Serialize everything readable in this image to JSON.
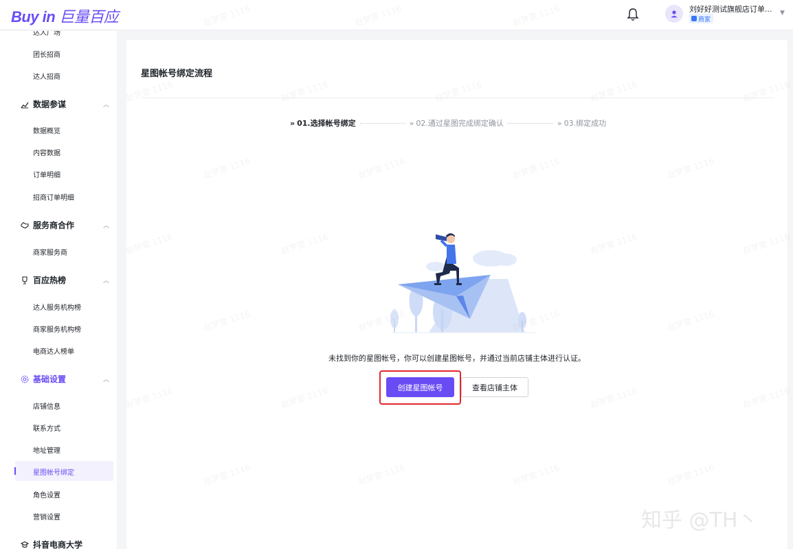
{
  "header": {
    "logo_text": "Buy in",
    "logo_cn": "巨量百应",
    "user_name": "刘好好测试旗舰店订单...",
    "user_role": "商家"
  },
  "sidebar": {
    "top_cut": "达人广场",
    "items_recruit": [
      "团长招商",
      "达人招商"
    ],
    "groups": [
      {
        "label": "数据参谋",
        "items": [
          "数据概览",
          "内容数据",
          "订单明细",
          "招商订单明细"
        ]
      },
      {
        "label": "服务商合作",
        "items": [
          "商家服务商"
        ]
      },
      {
        "label": "百应热榜",
        "items": [
          "达人服务机构榜",
          "商家服务机构榜",
          "电商达人榜单"
        ]
      },
      {
        "label": "基础设置",
        "items": [
          "店铺信息",
          "联系方式",
          "地址管理",
          "星图帐号绑定",
          "角色设置",
          "营销设置"
        ]
      },
      {
        "label": "抖音电商大学",
        "items": []
      }
    ],
    "active_item": "星图帐号绑定"
  },
  "main": {
    "title": "星图帐号绑定流程",
    "steps": [
      {
        "label": "01.选择帐号绑定",
        "active": true
      },
      {
        "label": "02.通过星图完成绑定确认",
        "active": false
      },
      {
        "label": "03.绑定成功",
        "active": false
      }
    ],
    "empty_message": "未找到你的星图帐号，你可以创建星图帐号，并通过当前店铺主体进行认证。",
    "primary_button": "创建星图帐号",
    "secondary_button": "查看店铺主体"
  },
  "watermark": "赵梦雯 1116",
  "corner_watermark": "知乎 @TH丶",
  "colors": {
    "accent": "#6a4cf5",
    "highlight_border": "#e0262b"
  }
}
